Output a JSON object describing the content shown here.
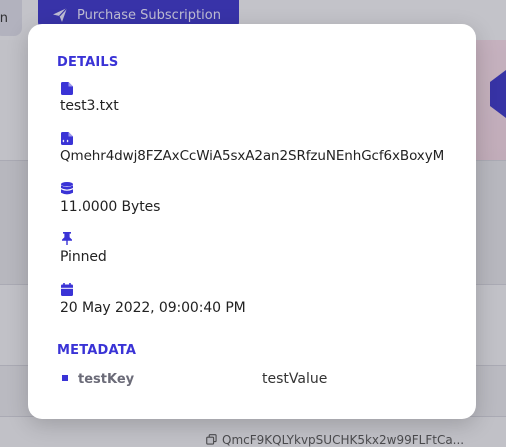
{
  "background": {
    "left_button_label": "n",
    "purchase_button_label": "Purchase Subscription",
    "footer_hash": "QmcF9KQLYkvpSUCHK5kx2w99FLFtCa..."
  },
  "modal": {
    "details_title": "DETAILS",
    "details": [
      {
        "icon": "file-icon",
        "value": "test3.txt"
      },
      {
        "icon": "file-code-icon",
        "value": "Qmehr4dwj8FZAxCcWiA5sxA2an2SRfzuNEnhGcf6xBoxyM"
      },
      {
        "icon": "database-icon",
        "value": "11.0000 Bytes"
      },
      {
        "icon": "pin-icon",
        "value": "Pinned"
      },
      {
        "icon": "calendar-icon",
        "value": "20 May 2022, 09:00:40 PM"
      }
    ],
    "metadata_title": "METADATA",
    "metadata": [
      {
        "key": "testKey",
        "value": "testValue"
      }
    ]
  },
  "colors": {
    "accent": "#3a33d6",
    "purchase_button": "#3d36c8"
  }
}
